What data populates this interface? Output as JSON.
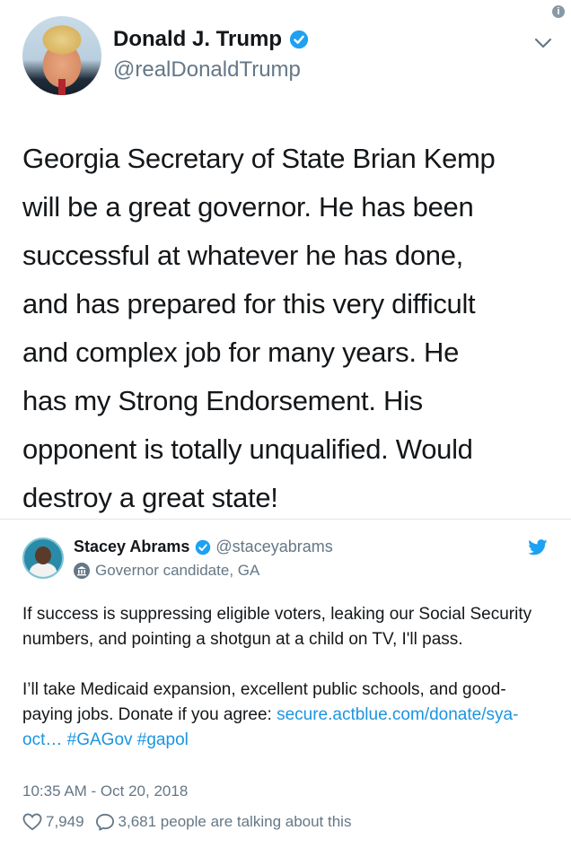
{
  "main_tweet": {
    "author_name": "Donald J. Trump",
    "handle": "@realDonaldTrump",
    "text_lines": [
      "Georgia Secretary of State Brian Kemp",
      "will be a great governor. He has been",
      "successful at whatever he has done,",
      "and has prepared for this very difficult",
      "and complex job for many years. He",
      "has my Strong Endorsement. His",
      "opponent is totally unqualified. Would",
      "destroy a great state!"
    ]
  },
  "quoted_tweet": {
    "author_name": "Stacey Abrams",
    "handle": "@staceyabrams",
    "label": "Governor candidate, GA",
    "paragraph1": "If success is suppressing eligible voters, leaking our Social Security numbers, and pointing a shotgun at a child on TV, I'll pass.",
    "paragraph2_text": "I’ll take Medicaid expansion, excellent public schools, and good-paying jobs. Donate if you agree: ",
    "link": "secure.actblue.com/donate/sya-oct…",
    "hashtag1": "#GAGov",
    "hashtag2": "#gapol",
    "timestamp": "10:35 AM - Oct 20, 2018",
    "likes": "7,949",
    "talking": "3,681 people are talking about this"
  },
  "icons": {
    "verified": "verified-badge-icon",
    "chevron": "chevron-down-icon",
    "info": "info-icon",
    "bird": "twitter-bird-icon",
    "heart": "heart-icon",
    "reply": "reply-icon",
    "government": "government-building-icon"
  },
  "colors": {
    "accent": "#1da1f2",
    "link": "#1b95e0",
    "secondary_text": "#657786"
  }
}
